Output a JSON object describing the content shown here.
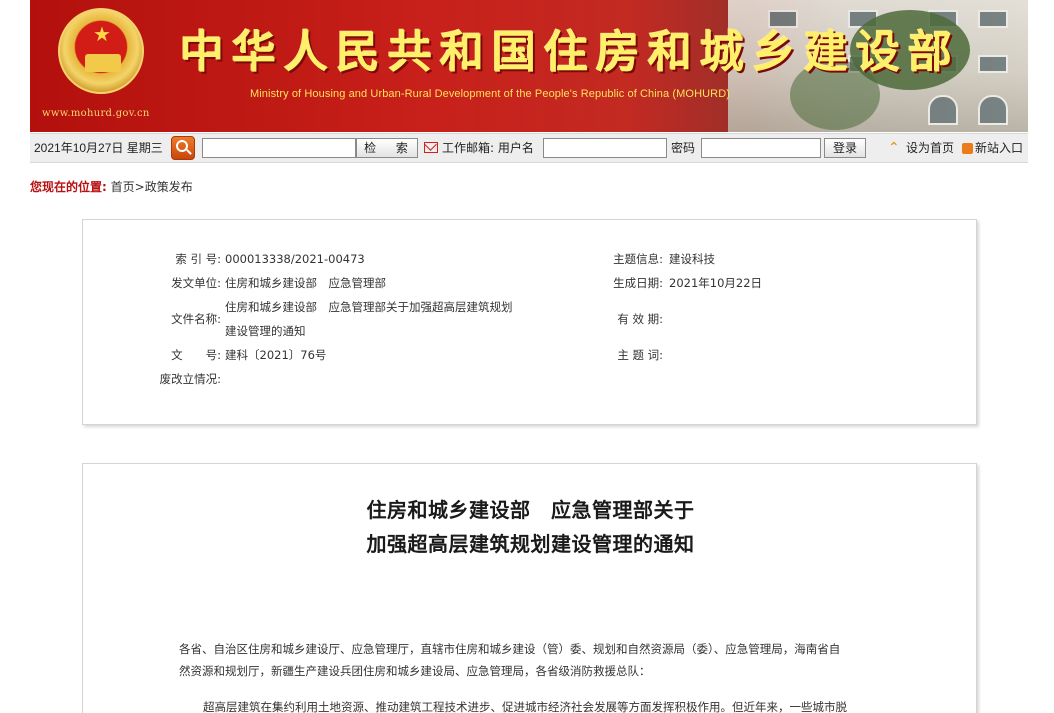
{
  "header": {
    "site_url": "www.mohurd.gov.cn",
    "title": "中华人民共和国住房和城乡建设部",
    "subtitle": "Ministry of Housing and Urban-Rural Development of the People's Republic of China (MOHURD)"
  },
  "toolbar": {
    "date": "2021年10月27日 星期三",
    "search_value": "",
    "search_button": "检 索",
    "mail_label": "工作邮箱: 用户名",
    "username_value": "",
    "password_label": "密码",
    "password_value": "",
    "login_button": "登录",
    "home_link": "设为首页",
    "new_site_link": "新站入口"
  },
  "breadcrumb": {
    "label": "您现在的位置:",
    "path": "首页>政策发布"
  },
  "info": {
    "index_label": "索 引 号:",
    "index_value": "000013338/2021-00473",
    "issuer_label": "发文单位:",
    "issuer_value": "住房和城乡建设部　应急管理部",
    "filename_label": "文件名称:",
    "filename_line1": "住房和城乡建设部　应急管理部关于加强超高层建筑规划",
    "filename_line2": "建设管理的通知",
    "docno_label": "文　　号:",
    "docno_value": "建科〔2021〕76号",
    "validity_change_label": "废改立情况:",
    "topic_label": "主题信息:",
    "topic_value": "建设科技",
    "date_label": "生成日期:",
    "date_value": "2021年10月22日",
    "valid_label": "有 效 期:",
    "keywords_label": "主 题 词:"
  },
  "article": {
    "title_line1": "住房和城乡建设部　应急管理部关于",
    "title_line2": "加强超高层建筑规划建设管理的通知",
    "para1_line1": "各省、自治区住房和城乡建设厅、应急管理厅，直辖市住房和城乡建设（管）委、规划和自然资源局（委）、应急管理局，海南省自",
    "para1_line2": "然资源和规划厅，新疆生产建设兵团住房和城乡建设局、应急管理局，各省级消防救援总队：",
    "para2_line1": "超高层建筑在集约利用土地资源、推动建筑工程技术进步、促进城市经济社会发展等方面发挥积极作用。但近年来，一些城市脱"
  },
  "colors": {
    "banner_red": "#c8201a",
    "title_yellow": "#fff06a",
    "breadcrumb_red": "#b81010",
    "search_orange": "#e0601a"
  }
}
